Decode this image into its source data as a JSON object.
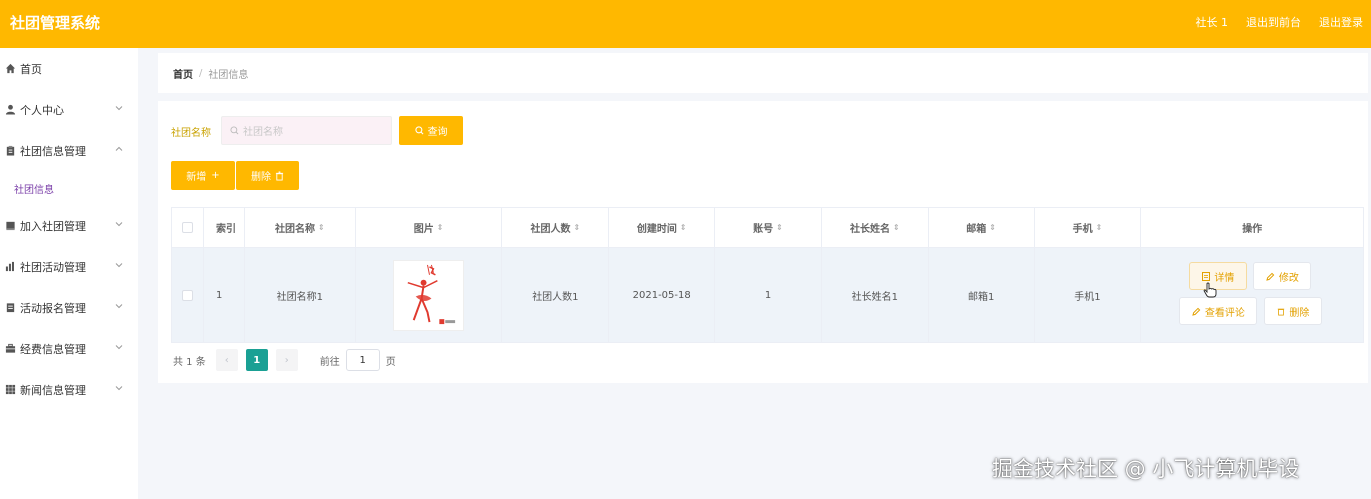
{
  "header": {
    "title": "社团管理系统",
    "user_label": "社长 1",
    "exit_to_front": "退出到前台",
    "logout": "退出登录",
    "bg_color": "#ffb800"
  },
  "sidebar": {
    "items": [
      {
        "label": "首页",
        "icon": "home-icon"
      },
      {
        "label": "个人中心",
        "icon": "user-icon"
      },
      {
        "label": "社团信息管理",
        "icon": "clipboard-icon",
        "expanded": true,
        "sub": "社团信息"
      },
      {
        "label": "加入社团管理",
        "icon": "doc-icon"
      },
      {
        "label": "社团活动管理",
        "icon": "bar-chart-icon"
      },
      {
        "label": "活动报名管理",
        "icon": "form-icon"
      },
      {
        "label": "经费信息管理",
        "icon": "briefcase-icon"
      },
      {
        "label": "新闻信息管理",
        "icon": "grid-icon"
      }
    ]
  },
  "breadcrumb": {
    "home": "首页",
    "separator": "/",
    "current": "社团信息"
  },
  "search": {
    "label": "社团名称",
    "placeholder": "社团名称",
    "query_button": "查询"
  },
  "actions": {
    "add": "新增",
    "delete": "删除"
  },
  "table": {
    "columns": [
      "索引",
      "社团名称",
      "图片",
      "社团人数",
      "创建时间",
      "账号",
      "社长姓名",
      "邮箱",
      "手机",
      "操作"
    ],
    "rows": [
      {
        "index": "1",
        "name": "社团名称1",
        "count": "社团人数1",
        "created": "2021-05-18",
        "account": "1",
        "leader": "社长姓名1",
        "email": "邮箱1",
        "phone": "手机1",
        "ops": {
          "detail": "详情",
          "edit": "修改",
          "comments": "查看评论",
          "delete": "删除"
        }
      }
    ]
  },
  "pagination": {
    "total": "共 1 条",
    "current_page": "1",
    "goto_label": "前往",
    "goto_value": "1",
    "page_unit": "页"
  },
  "watermark": "掘金技术社区 @ 小飞计算机毕设"
}
